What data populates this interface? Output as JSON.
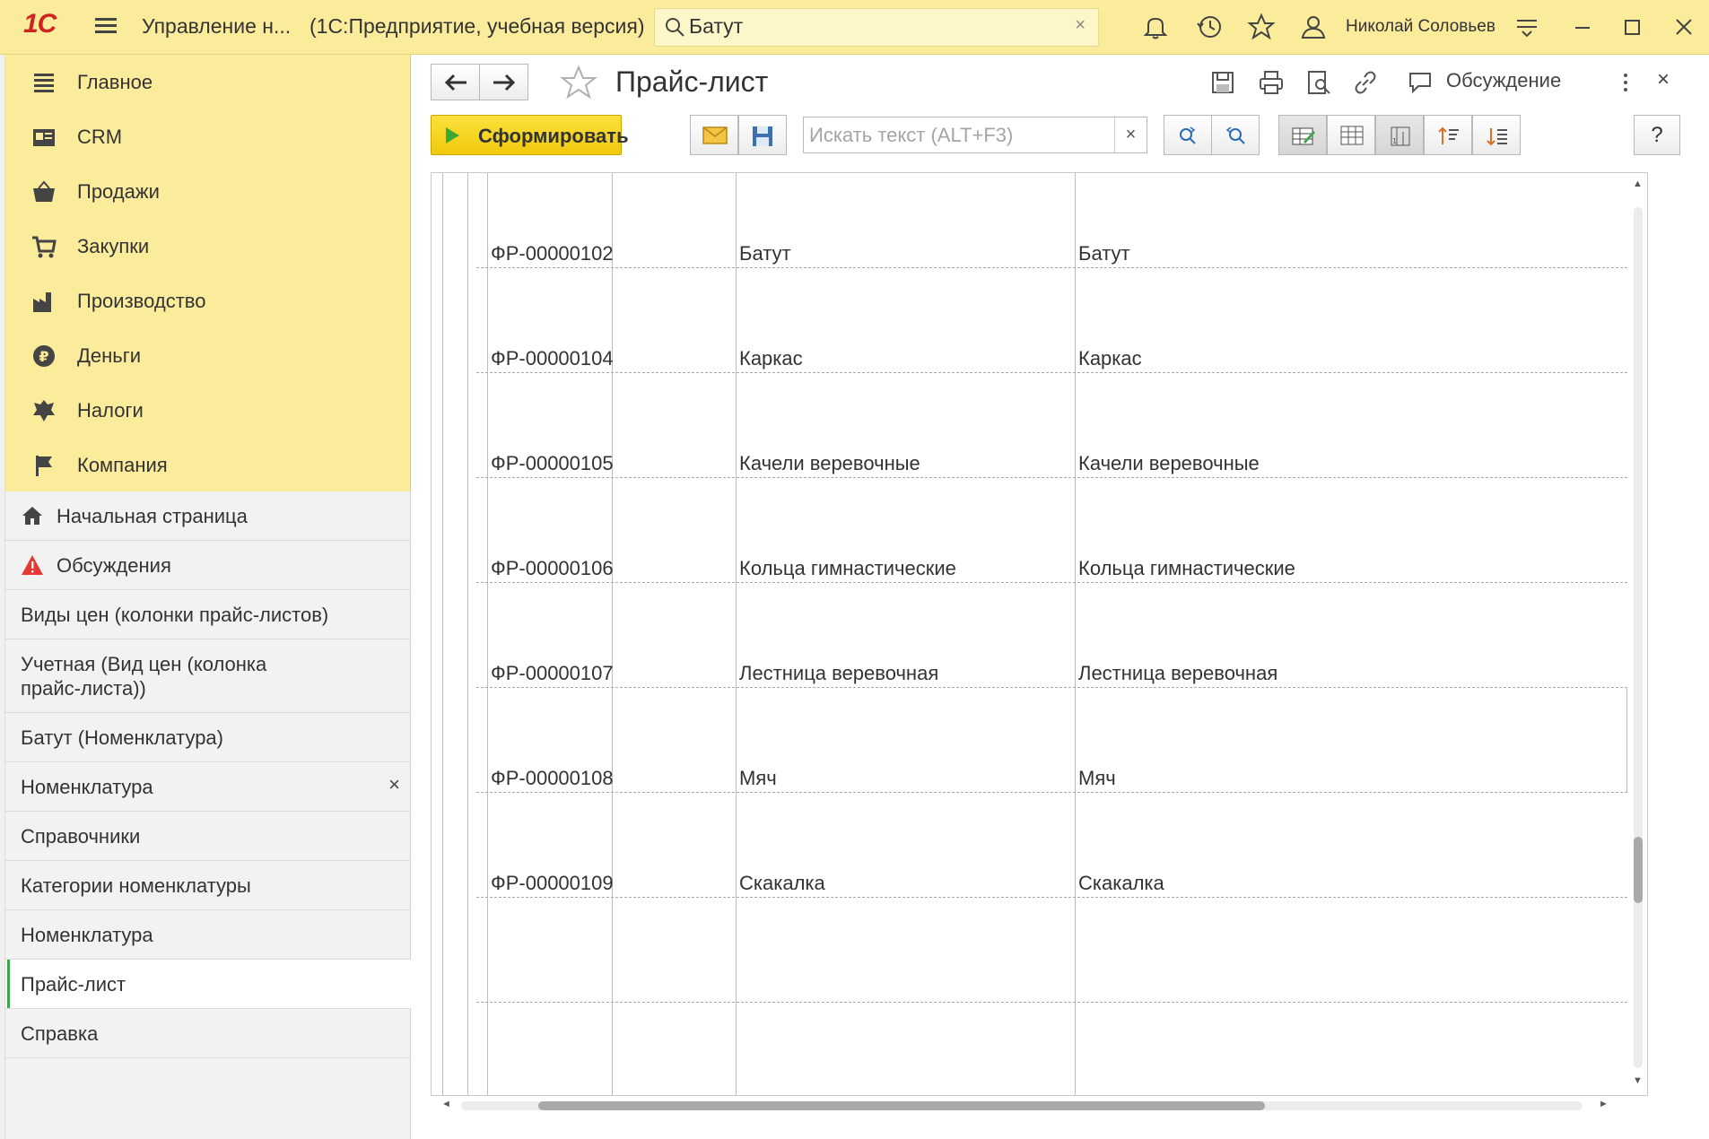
{
  "topbar": {
    "logo_text": "1С",
    "app_title": "Управление н...",
    "app_subtitle": "(1С:Предприятие, учебная версия)",
    "search_value": "Батут",
    "user_name": "Николай Соловьев",
    "icons": [
      "menu-icon",
      "search-icon",
      "clear-icon",
      "bell-icon",
      "history-icon",
      "star-icon",
      "users-icon",
      "settings-list-icon",
      "minimize-icon",
      "maximize-icon",
      "close-icon"
    ]
  },
  "sections": [
    {
      "label": "Главное",
      "icon": "menu-lines-icon"
    },
    {
      "label": "CRM",
      "icon": "crm-card-icon"
    },
    {
      "label": "Продажи",
      "icon": "basket-icon"
    },
    {
      "label": "Закупки",
      "icon": "cart-icon"
    },
    {
      "label": "Производство",
      "icon": "factory-icon"
    },
    {
      "label": "Деньги",
      "icon": "ruble-icon"
    },
    {
      "label": "Налоги",
      "icon": "emblem-icon"
    },
    {
      "label": "Компания",
      "icon": "flag-icon"
    }
  ],
  "open_windows": [
    {
      "label": "Начальная страница",
      "icon": "home-icon"
    },
    {
      "label": "Обсуждения",
      "icon": "warning-icon"
    },
    {
      "label": "Виды цен (колонки прайс-листов)"
    },
    {
      "label": "Учетная (Вид цен (колонка прайс-листа))"
    },
    {
      "label": "Батут (Номенклатура)"
    },
    {
      "label": "Номенклатура",
      "closable": true
    },
    {
      "label": "Справочники"
    },
    {
      "label": "Категории номенклатуры"
    },
    {
      "label": "Номенклатура"
    },
    {
      "label": "Прайс-лист",
      "active": true
    },
    {
      "label": "Справка"
    }
  ],
  "form": {
    "title": "Прайс-лист",
    "discuss_label": "Обсуждение",
    "generate_label": "Сформировать",
    "search_placeholder": "Искать текст (ALT+F3)",
    "help_label": "?",
    "close_label": "×"
  },
  "table": {
    "rows": [
      {
        "code": "ФР-00000102",
        "name": "Батут",
        "name2": "Батут"
      },
      {
        "code": "ФР-00000104",
        "name": "Каркас",
        "name2": "Каркас"
      },
      {
        "code": "ФР-00000105",
        "name": "Качели веревочные",
        "name2": "Качели веревочные"
      },
      {
        "code": "ФР-00000106",
        "name": "Кольца гимнастические",
        "name2": "Кольца гимнастические"
      },
      {
        "code": "ФР-00000107",
        "name": "Лестница веревочная",
        "name2": "Лестница веревочная"
      },
      {
        "code": "ФР-00000108",
        "name": "Мяч",
        "name2": "Мяч"
      },
      {
        "code": "ФР-00000109",
        "name": "Скакалка",
        "name2": "Скакалка"
      }
    ]
  },
  "colors": {
    "accent_yellow": "#fbec9c",
    "generate_button": "#f1c90d",
    "active_marker": "#3aa54a",
    "logo_red": "#d0221f"
  }
}
